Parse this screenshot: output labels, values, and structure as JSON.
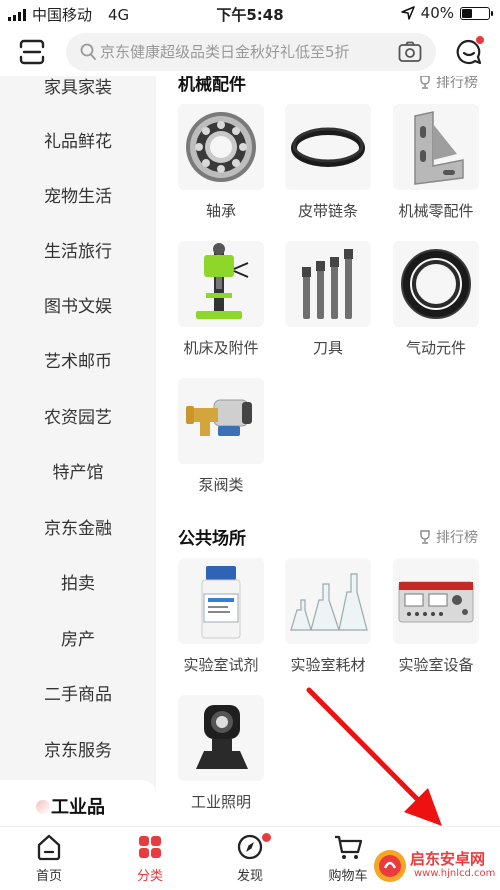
{
  "status": {
    "carrier": "中国移动",
    "network": "4G",
    "time": "下午5:48",
    "battery": "40%",
    "battery_level": 0.4
  },
  "search": {
    "placeholder": "京东健康超级品类日金秋好礼低至5折"
  },
  "sidebar": {
    "items": [
      {
        "label": "家具家装"
      },
      {
        "label": "礼品鲜花"
      },
      {
        "label": "宠物生活"
      },
      {
        "label": "生活旅行"
      },
      {
        "label": "图书文娱"
      },
      {
        "label": "艺术邮币"
      },
      {
        "label": "农资园艺"
      },
      {
        "label": "特产馆"
      },
      {
        "label": "京东金融"
      },
      {
        "label": "拍卖"
      },
      {
        "label": "房产"
      },
      {
        "label": "二手商品"
      },
      {
        "label": "京东服务"
      },
      {
        "label": "工业品",
        "active": true
      }
    ]
  },
  "sections": [
    {
      "title": "机械配件",
      "rank_label": "排行榜",
      "products": [
        {
          "label": "轴承",
          "icon": "bearing"
        },
        {
          "label": "皮带链条",
          "icon": "belt"
        },
        {
          "label": "机械零配件",
          "icon": "bracket"
        },
        {
          "label": "机床及附件",
          "icon": "drill-press"
        },
        {
          "label": "刀具",
          "icon": "taps"
        },
        {
          "label": "气动元件",
          "icon": "hose-coil"
        },
        {
          "label": "泵阀类",
          "icon": "pump"
        }
      ]
    },
    {
      "title": "公共场所",
      "rank_label": "排行榜",
      "products": [
        {
          "label": "实验室试剂",
          "icon": "reagent-bottle"
        },
        {
          "label": "实验室耗材",
          "icon": "flasks"
        },
        {
          "label": "实验室设备",
          "icon": "lab-instrument"
        },
        {
          "label": "工业照明",
          "icon": "search-light"
        }
      ]
    }
  ],
  "tabbar": {
    "tabs": [
      {
        "label": "首页",
        "icon": "home-icon"
      },
      {
        "label": "分类",
        "icon": "category-icon",
        "active": true
      },
      {
        "label": "发现",
        "icon": "compass-icon",
        "dot": true
      },
      {
        "label": "购物车",
        "icon": "cart-icon"
      }
    ]
  },
  "watermark": {
    "text": "启东安卓网",
    "url": "www.hjnlcd.com"
  },
  "colors": {
    "accent": "#e93b3d",
    "sidebar_bg": "#f5f5f5",
    "thumb_bg": "#f6f6f6"
  }
}
